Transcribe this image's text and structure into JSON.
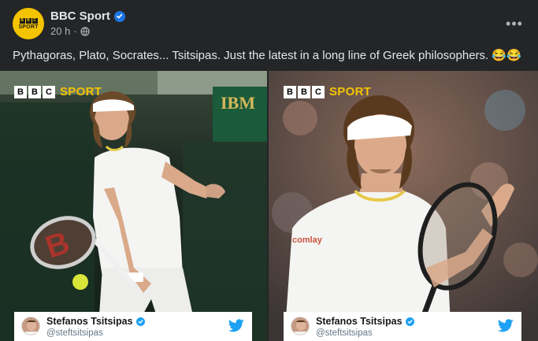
{
  "post": {
    "page_name": "BBC Sport",
    "time": "20 h",
    "separator": "·",
    "privacy_icon": "globe-icon",
    "more_icon": "ellipsis-icon",
    "more_label": "•••",
    "text": "Pythagoras, Plato, Socrates... Tsitsipas. Just the latest in a long line of Greek philosophers. 😂😂"
  },
  "avatar": {
    "blocks": [
      "B",
      "B",
      "C"
    ],
    "word": "SPORT"
  },
  "photos": [
    {
      "logo_blocks": [
        "B",
        "B",
        "C"
      ],
      "logo_word": "SPORT",
      "tweet": {
        "name": "Stefanos Tsitsipas",
        "handle": "@steftsitsipas"
      }
    },
    {
      "logo_blocks": [
        "B",
        "B",
        "C"
      ],
      "logo_word": "SPORT",
      "tweet": {
        "name": "Stefanos Tsitsipas",
        "handle": "@steftsitsipas"
      }
    }
  ],
  "colors": {
    "background": "#242526",
    "bbc_yellow": "#f5c400",
    "verified_blue": "#1b74e4",
    "twitter_blue": "#1da1f2"
  }
}
